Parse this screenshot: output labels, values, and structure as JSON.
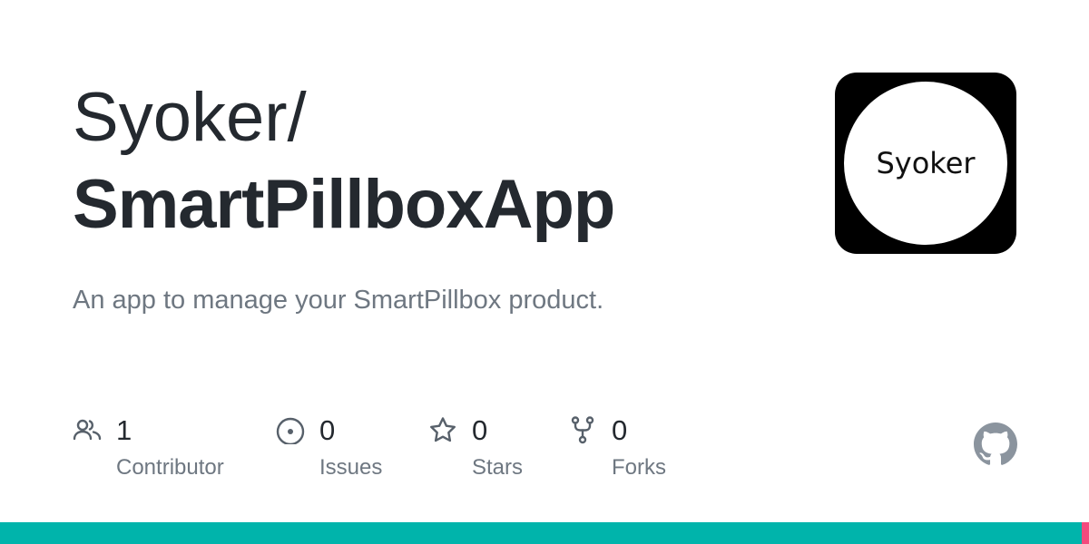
{
  "repo": {
    "owner": "Syoker/",
    "name": "SmartPillboxApp",
    "description": "An app to manage your SmartPillbox product."
  },
  "avatar": {
    "text": "Syoker"
  },
  "stats": [
    {
      "icon": "people-icon",
      "count": "1",
      "label": "Contributor"
    },
    {
      "icon": "issue-opened-icon",
      "count": "0",
      "label": "Issues"
    },
    {
      "icon": "star-icon",
      "count": "0",
      "label": "Stars"
    },
    {
      "icon": "repo-forked-icon",
      "count": "0",
      "label": "Forks"
    }
  ],
  "brand_icon": "github-mark-icon",
  "colors": {
    "text_primary": "#24292f",
    "text_secondary": "#6e7781",
    "icon": "#57606a",
    "github_mark": "#8b949e",
    "language_primary": "#00b4ab",
    "language_secondary": "#f34b7d"
  },
  "language_bar": [
    {
      "color": "#00b4ab",
      "share": 0.993
    },
    {
      "color": "#f34b7d",
      "share": 0.007
    }
  ]
}
